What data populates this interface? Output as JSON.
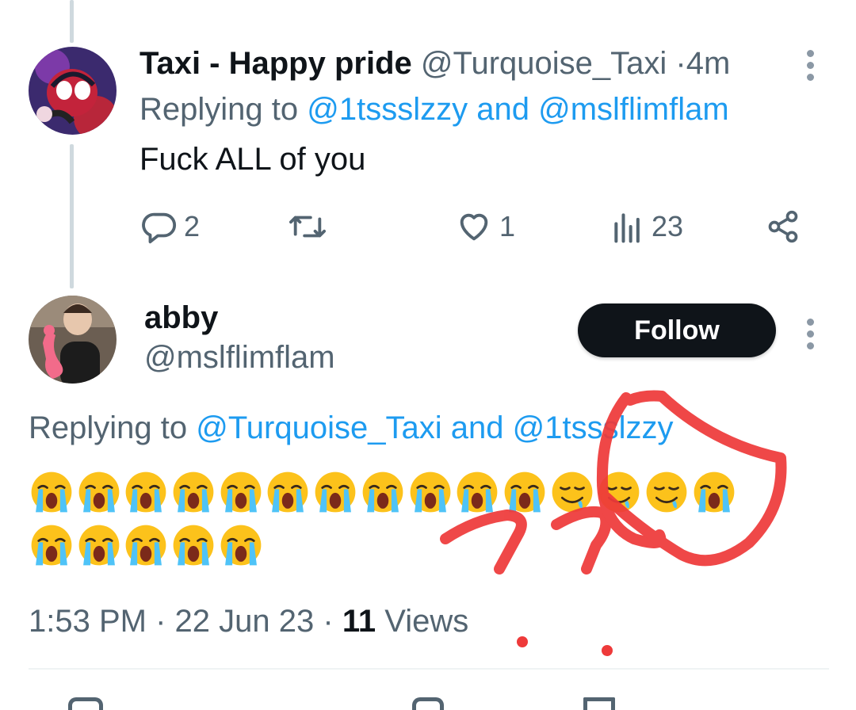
{
  "tweet1": {
    "display_name": "Taxi - Happy pride",
    "handle": "@Turquoise_Taxi",
    "separator": "·",
    "time": "4m",
    "replying_prefix": "Replying to",
    "reply_to_1": "@1tssslzzy",
    "reply_and": "and",
    "reply_to_2": "@mslflimflam",
    "text": "Fuck ALL of you",
    "actions": {
      "replies": "2",
      "retweets": "",
      "likes": "1",
      "views": "23"
    },
    "icons": [
      "reply-icon",
      "retweet-icon",
      "like-icon",
      "views-icon",
      "share-icon",
      "more-icon"
    ]
  },
  "tweet2": {
    "display_name": "abby",
    "handle": "@mslflimflam",
    "follow_label": "Follow",
    "replying_prefix": "Replying to",
    "reply_to_1": "@Turquoise_Taxi",
    "reply_and": "and",
    "reply_to_2": "@1tssslzzy",
    "emojis": {
      "line1": [
        "loudly-crying",
        "loudly-crying",
        "loudly-crying",
        "loudly-crying",
        "loudly-crying",
        "loudly-crying",
        "loudly-crying",
        "loudly-crying",
        "loudly-crying",
        "loudly-crying",
        "loudly-crying",
        "drooling",
        "drooling",
        "drooling",
        "loudly-crying"
      ],
      "line2": [
        "loudly-crying",
        "loudly-crying",
        "loudly-crying",
        "loudly-crying",
        "loudly-crying"
      ]
    },
    "meta": {
      "time": "1:53 PM",
      "sep": "·",
      "date": "22 Jun 23",
      "views_count": "11",
      "views_label": "Views"
    }
  },
  "colors": {
    "accent": "#1d9bf0",
    "text": "#0f1419",
    "secondary": "#536471",
    "thread_line": "#cfd9de",
    "annotation": "#ee3a3a"
  }
}
